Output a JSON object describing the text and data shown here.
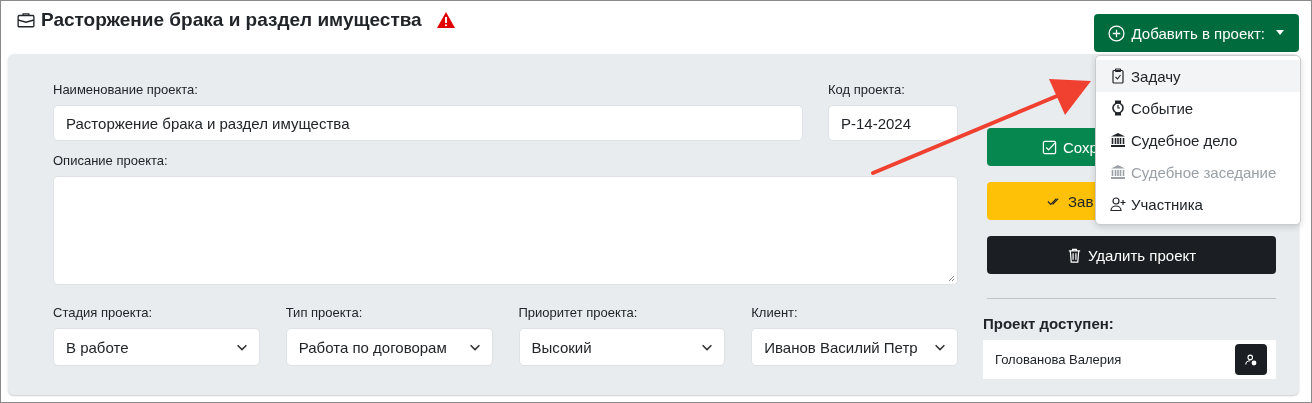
{
  "header": {
    "title": "Расторжение брака и раздел имущества",
    "warning": true,
    "add_button": "Добавить в проект:"
  },
  "form": {
    "name": {
      "label": "Наименование проекта:",
      "value": "Расторжение брака и раздел имущества"
    },
    "code": {
      "label": "Код проекта:",
      "value": "Р-14-2024"
    },
    "description": {
      "label": "Описание проекта:"
    },
    "selects": [
      {
        "label": "Стадия проекта:",
        "value": "В работе"
      },
      {
        "label": "Тип проекта:",
        "value": "Работа по договорам"
      },
      {
        "label": "Приоритет проекта:",
        "value": "Высокий"
      },
      {
        "label": "Клиент:",
        "value": "Иванов Василий Петр"
      }
    ]
  },
  "actions": [
    {
      "label": "Сохр",
      "kind": "success"
    },
    {
      "label": "Зав",
      "kind": "warning"
    },
    {
      "label": "Удалить проект",
      "kind": "dark"
    }
  ],
  "access": {
    "title": "Проект доступен:",
    "users": [
      {
        "name": "Голованова Валерия"
      }
    ]
  },
  "dropdown": {
    "open": true,
    "items": [
      {
        "label": "Задачу",
        "selected": true,
        "disabled": false
      },
      {
        "label": "Событие",
        "selected": false,
        "disabled": false
      },
      {
        "label": "Судебное дело",
        "selected": false,
        "disabled": false
      },
      {
        "label": "Судебное заседание",
        "selected": false,
        "disabled": true
      },
      {
        "label": "Участника",
        "selected": false,
        "disabled": false
      }
    ]
  }
}
